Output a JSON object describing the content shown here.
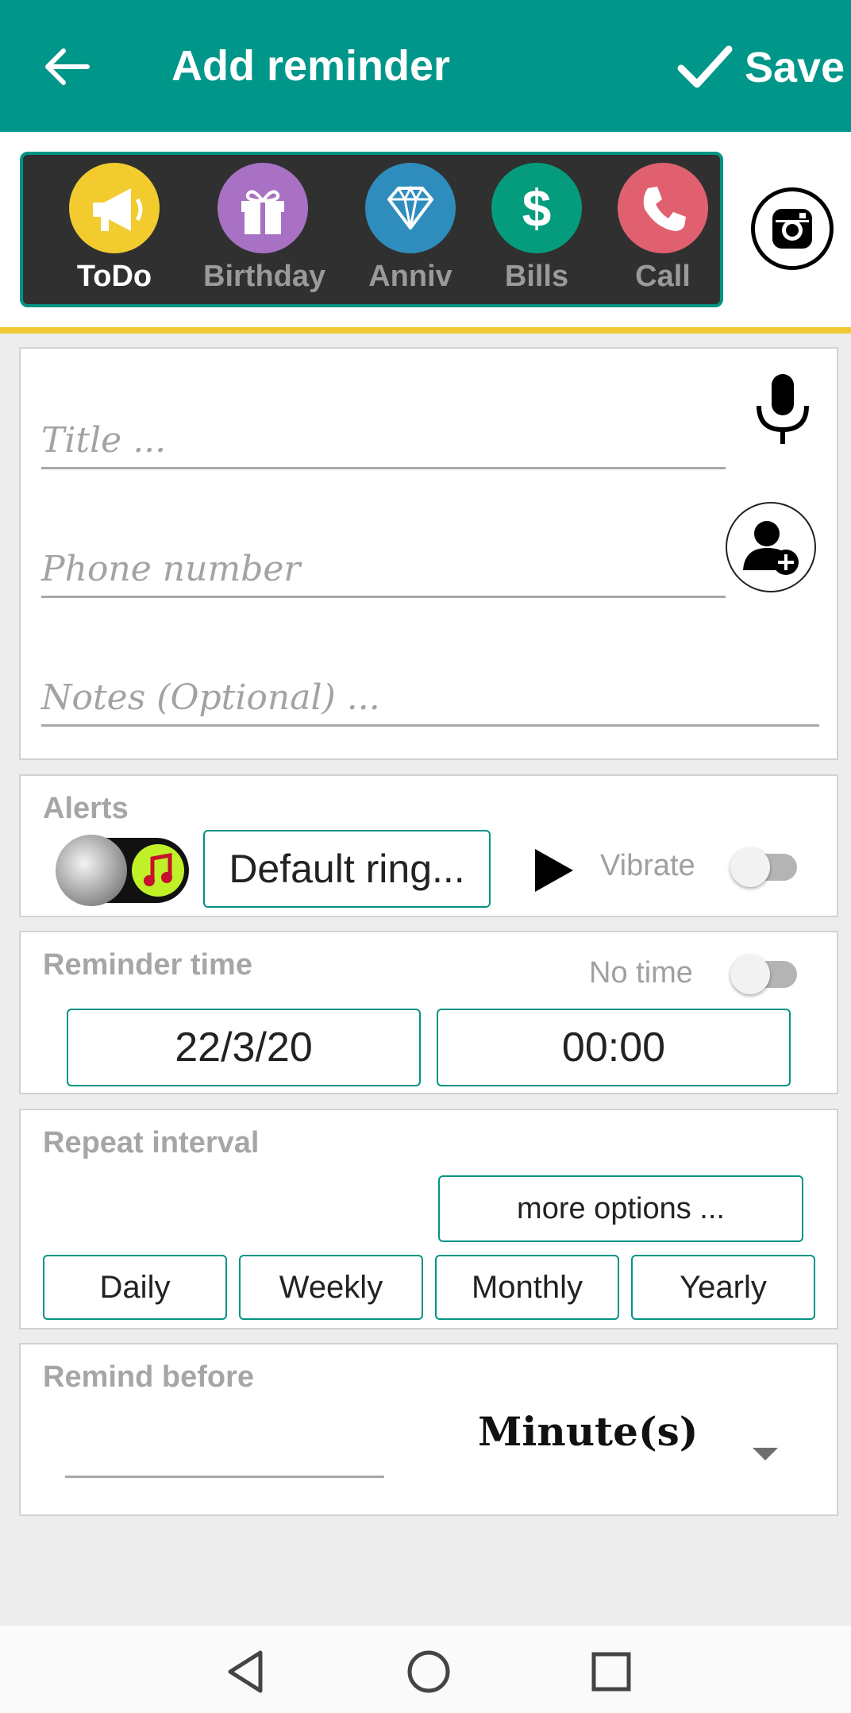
{
  "header": {
    "title": "Add reminder",
    "save_label": "Save",
    "back_icon": "arrow-left-icon",
    "save_icon": "checkmark-icon"
  },
  "categories": [
    {
      "label": "ToDo",
      "icon": "megaphone-icon",
      "color": "#f2cb2f",
      "active": true
    },
    {
      "label": "Birthday",
      "icon": "gift-icon",
      "color": "#a871c4",
      "active": false
    },
    {
      "label": "Anniv",
      "icon": "diamond-icon",
      "color": "#2e8dbd",
      "active": false
    },
    {
      "label": "Bills",
      "icon": "dollar-icon",
      "color": "#049c7c",
      "active": false
    },
    {
      "label": "Call",
      "icon": "phone-icon",
      "color": "#e06070",
      "active": false
    }
  ],
  "form": {
    "title_placeholder": "Title ...",
    "phone_placeholder": "Phone number",
    "notes_placeholder": "Notes (Optional) ..."
  },
  "alerts": {
    "label": "Alerts",
    "ringtone": "Default ring...",
    "vibrate_label": "Vibrate",
    "vibrate_on": false
  },
  "reminder_time": {
    "label": "Reminder time",
    "no_time_label": "No time",
    "no_time_on": false,
    "date": "22/3/20",
    "time": "00:00"
  },
  "repeat": {
    "label": "Repeat interval",
    "more_options": "more options ...",
    "options": [
      "Daily",
      "Weekly",
      "Monthly",
      "Yearly"
    ]
  },
  "remind_before": {
    "label": "Remind before",
    "unit": "Minute(s)",
    "value": ""
  },
  "colors": {
    "primary": "#00968a",
    "accent_line": "#f0c832",
    "strip_bg": "#303030"
  }
}
